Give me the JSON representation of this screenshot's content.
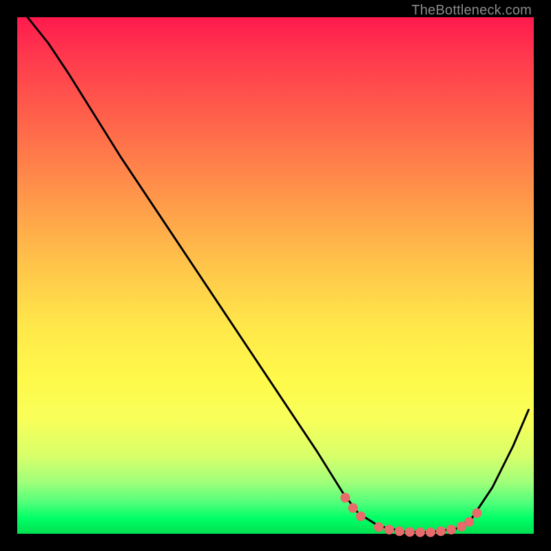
{
  "attribution": "TheBottleneck.com",
  "chart_data": {
    "type": "line",
    "title": "",
    "xlabel": "",
    "ylabel": "",
    "xlim": [
      0,
      100
    ],
    "ylim": [
      0,
      100
    ],
    "background_gradient": [
      "#ff1a4d",
      "#ffe84a",
      "#00e050"
    ],
    "curve": [
      {
        "x": 2,
        "y": 100
      },
      {
        "x": 6,
        "y": 95
      },
      {
        "x": 10,
        "y": 89
      },
      {
        "x": 20,
        "y": 73
      },
      {
        "x": 30,
        "y": 58
      },
      {
        "x": 40,
        "y": 43
      },
      {
        "x": 50,
        "y": 28
      },
      {
        "x": 58,
        "y": 16
      },
      {
        "x": 63,
        "y": 8
      },
      {
        "x": 66,
        "y": 4
      },
      {
        "x": 70,
        "y": 1.5
      },
      {
        "x": 75,
        "y": 0.4
      },
      {
        "x": 80,
        "y": 0.3
      },
      {
        "x": 85,
        "y": 1.0
      },
      {
        "x": 88,
        "y": 3
      },
      {
        "x": 92,
        "y": 9
      },
      {
        "x": 96,
        "y": 17
      },
      {
        "x": 99,
        "y": 24
      }
    ],
    "markers": [
      {
        "x": 63.5,
        "y": 7.0
      },
      {
        "x": 65.0,
        "y": 5.0
      },
      {
        "x": 66.5,
        "y": 3.4
      },
      {
        "x": 70.0,
        "y": 1.3
      },
      {
        "x": 72.0,
        "y": 0.8
      },
      {
        "x": 74.0,
        "y": 0.5
      },
      {
        "x": 76.0,
        "y": 0.35
      },
      {
        "x": 78.0,
        "y": 0.3
      },
      {
        "x": 80.0,
        "y": 0.3
      },
      {
        "x": 82.0,
        "y": 0.5
      },
      {
        "x": 84.0,
        "y": 0.8
      },
      {
        "x": 86.0,
        "y": 1.4
      },
      {
        "x": 87.5,
        "y": 2.3
      },
      {
        "x": 89.0,
        "y": 4.0
      }
    ],
    "marker_color": "#e86a6a",
    "marker_radius_px": 7
  }
}
